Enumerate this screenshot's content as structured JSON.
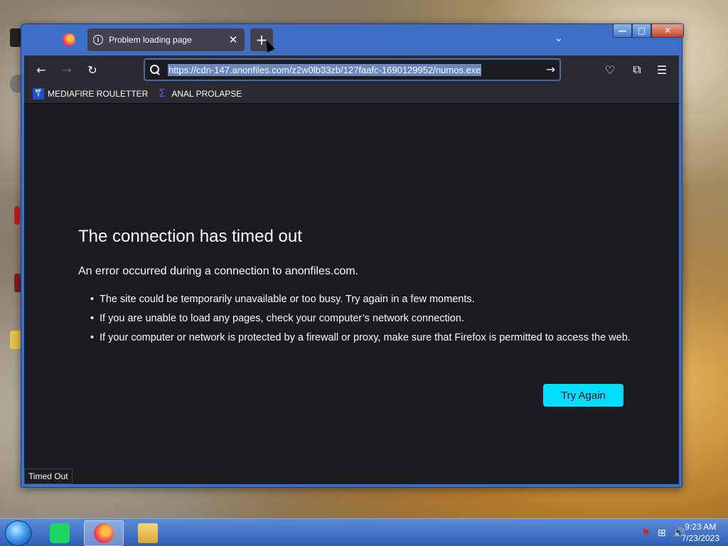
{
  "browser": {
    "tab": {
      "title": "Problem loading page"
    },
    "new_tab_label": "+",
    "url": "https://cdn-147.anonfiles.com/z2w0lb33zb/127faafc-1690129952/numos.exe",
    "bookmarks": [
      {
        "label": "MEDIAFIRE ROULETTER",
        "favicon_text": "MF\nT"
      },
      {
        "label": "ANAL PROLAPSE",
        "favicon_text": "Σ"
      }
    ]
  },
  "error_page": {
    "title": "The connection has timed out",
    "subtitle": "An error occurred during a connection to anonfiles.com.",
    "items": [
      "The site could be temporarily unavailable or too busy. Try again in a few moments.",
      "If you are unable to load any pages, check your computer’s network connection.",
      "If your computer or network is protected by a firewall or proxy, make sure that Firefox is permitted to access the web."
    ],
    "try_again_label": "Try Again"
  },
  "status_text": "Timed Out",
  "taskbar": {
    "apps": [
      "spotify-icon",
      "firefox-icon",
      "file-explorer-icon"
    ],
    "tray_icons": [
      "flag-icon",
      "network-icon",
      "volume-icon"
    ],
    "time": "9:23 AM",
    "date": "7/23/2023"
  },
  "colors": {
    "accent": "#00ddff",
    "titlebar": "#3f6fc4",
    "page_bg": "#1c1b22"
  }
}
